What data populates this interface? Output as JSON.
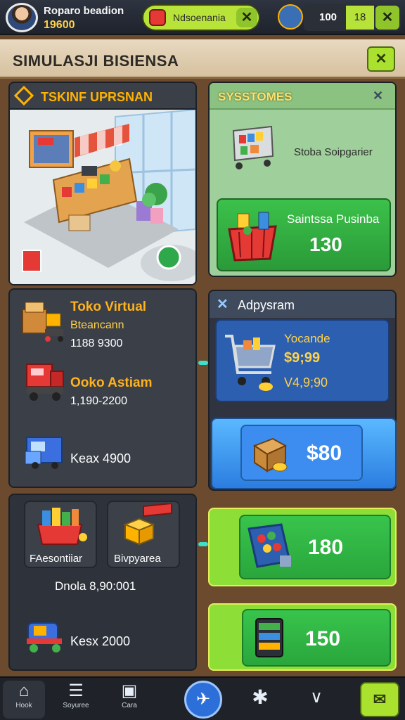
{
  "top_bar": {
    "player_name": "Roparo beadion",
    "player_coins": "19600",
    "pill1_text": "Ndsoenania",
    "pill1_close": "✕",
    "pill2_value": "100",
    "pill2_box": "18",
    "pill2_close": "✕"
  },
  "title_bar": {
    "title": "SIMULASJI BISIENSA",
    "action": "✕"
  },
  "shop_panel": {
    "title": "TSKINF UPRSNAN"
  },
  "systems_panel": {
    "title": "SYSSTOMES",
    "close": "✕",
    "description": "Stoba Soipgarier",
    "cta_label": "Saintssa Pusinba",
    "cta_value": "130"
  },
  "store_list": {
    "items": [
      {
        "title": "Toko Virtual",
        "subtitle": "Bteancann",
        "value": "1188 9300"
      },
      {
        "title": "Ooko Astiam",
        "value": "1,190-2200"
      },
      {
        "title": "Keax 4900"
      }
    ]
  },
  "upgrade_panel": {
    "title": "Adpysram",
    "close": "✕",
    "line1": "Yocande",
    "line2": "$9;99",
    "line3": "V4,9;90",
    "button_value": "$80"
  },
  "bottom_left": {
    "tile1": "FAesontiiar",
    "tile2": "Bivpyarea",
    "caption": "Dnola 8,90:001",
    "item_value": "Kesx 2000"
  },
  "green_buttons": {
    "first": "180",
    "second": "150"
  },
  "bottom_nav": {
    "items": [
      {
        "label": "Hook",
        "icon": "home-icon"
      },
      {
        "label": "Soyuree",
        "icon": "list-icon"
      },
      {
        "label": "Cara",
        "icon": "bag-icon"
      }
    ],
    "fab_icon": "x-plane-icon",
    "chevron": "∨",
    "right_icon": "check-mail-icon"
  },
  "colors": {
    "accent_orange": "#ffb21e",
    "accent_green": "#38c44c",
    "accent_lime": "#a9e12e",
    "accent_blue": "#2c5fb0"
  }
}
